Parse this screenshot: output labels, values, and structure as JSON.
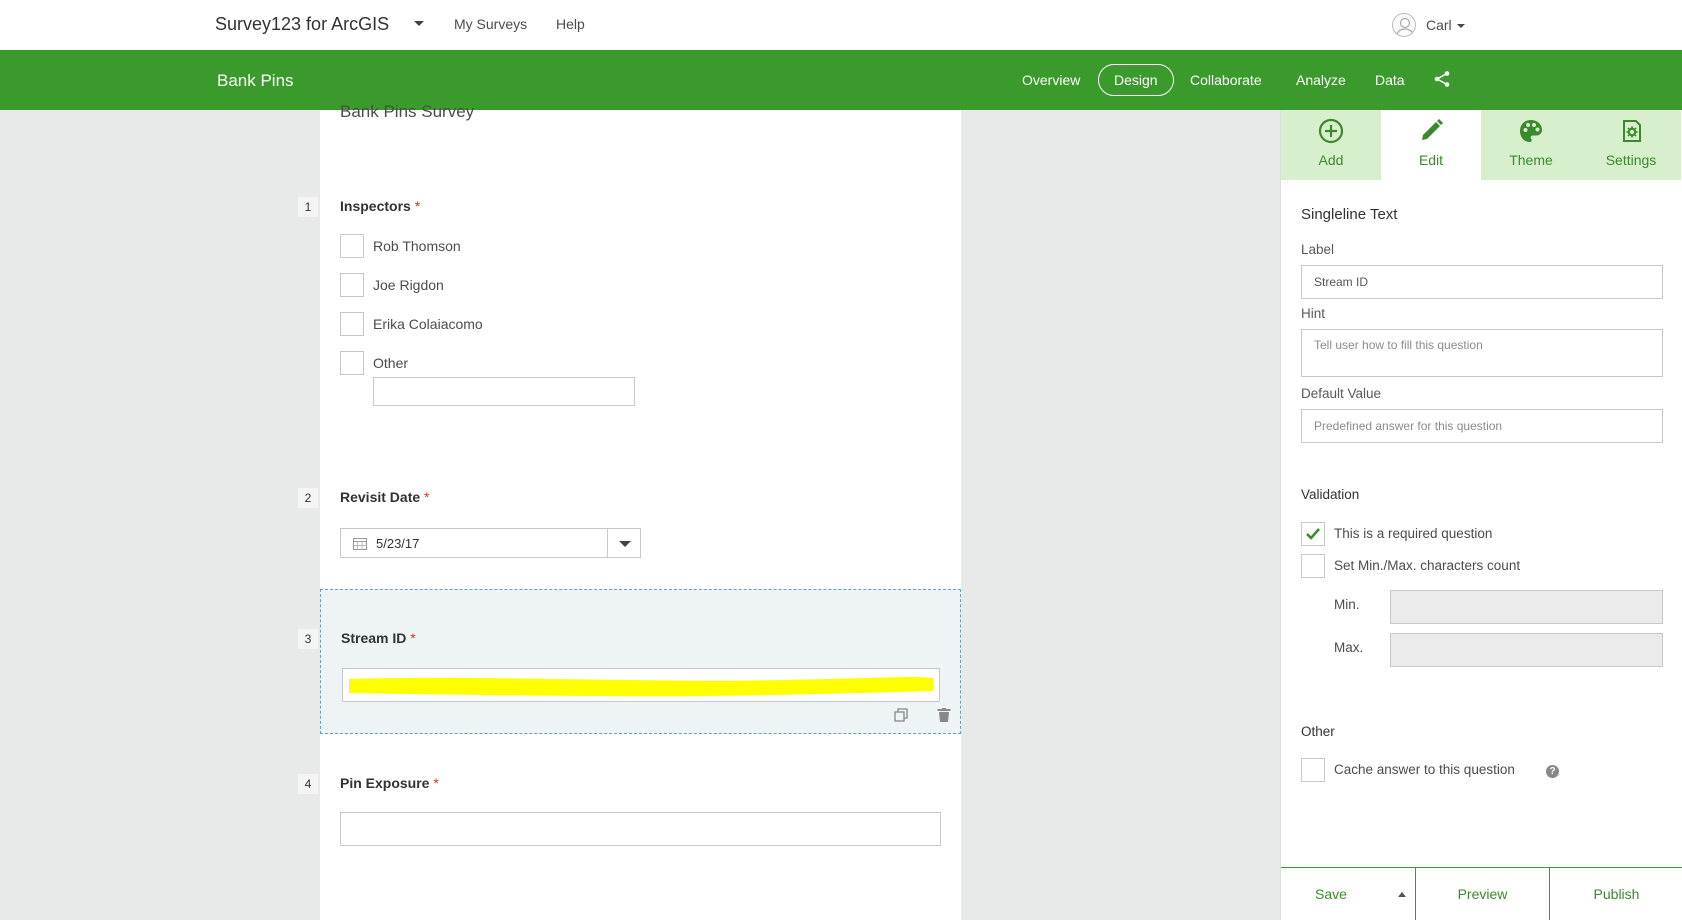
{
  "header": {
    "app_title": "Survey123 for ArcGIS",
    "nav": [
      "My Surveys",
      "Help"
    ],
    "user_name": "Carl"
  },
  "surveybar": {
    "survey_name": "Bank Pins",
    "tabs": [
      "Overview",
      "Design",
      "Collaborate",
      "Analyze",
      "Data"
    ],
    "active_tab": "Design"
  },
  "form": {
    "title": "Bank Pins Survey",
    "q1": {
      "number": "1",
      "label": "Inspectors",
      "options": [
        "Rob Thomson",
        "Joe Rigdon",
        "Erika Colaiacomo",
        "Other"
      ]
    },
    "q2": {
      "number": "2",
      "label": "Revisit Date",
      "value": "5/23/17"
    },
    "q3": {
      "number": "3",
      "label": "Stream ID"
    },
    "q4": {
      "number": "4",
      "label": "Pin Exposure"
    },
    "required_mark": "*"
  },
  "panel": {
    "tabs": [
      {
        "label": "Add",
        "icon": "add-circle-icon"
      },
      {
        "label": "Edit",
        "icon": "pencil-icon"
      },
      {
        "label": "Theme",
        "icon": "palette-icon"
      },
      {
        "label": "Settings",
        "icon": "settings-gear-icon"
      }
    ],
    "active_tab": "Edit",
    "question_type": "Singleline Text",
    "label_caption": "Label",
    "label_value": "Stream ID",
    "hint_caption": "Hint",
    "hint_placeholder": "Tell user how to fill this question",
    "default_caption": "Default Value",
    "default_placeholder": "Predefined answer for this question",
    "validation_heading": "Validation",
    "required_label": "This is a required question",
    "required_checked": true,
    "minmax_label": "Set Min./Max. characters count",
    "min_label": "Min.",
    "max_label": "Max.",
    "other_heading": "Other",
    "cache_label": "Cache answer to this question",
    "help_glyph": "?",
    "footer": {
      "save": "Save",
      "preview": "Preview",
      "publish": "Publish"
    },
    "accent_color": "#3a9a2b"
  }
}
